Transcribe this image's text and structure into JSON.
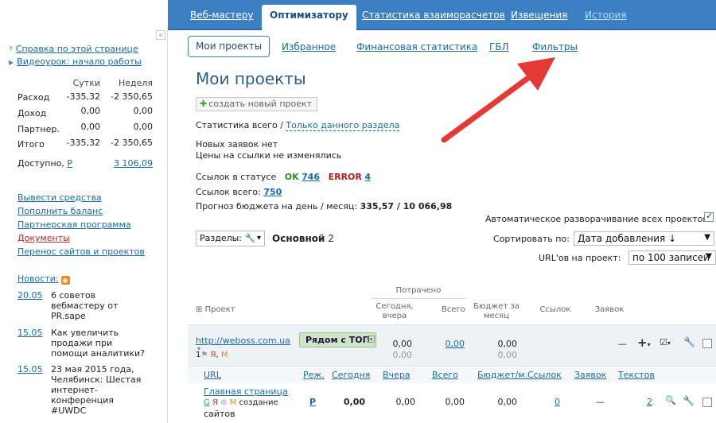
{
  "top_nav": [
    {
      "label": "Веб-мастеру"
    },
    {
      "label": "Оптимизатору"
    },
    {
      "label": "Статистика взаиморасчетов"
    },
    {
      "label": "Извещения"
    },
    {
      "label": "История"
    }
  ],
  "sidebar": {
    "collapse": "«",
    "help_link": "Справка по этой странице",
    "video_link": "Видеоурок: начало работы",
    "col_day": "Сутки",
    "col_week": "Неделя",
    "rows": [
      {
        "label": "Расход",
        "day": "-335,32",
        "week": "-2 350,65"
      },
      {
        "label": "Доход",
        "day": "0,00",
        "week": "0,00"
      },
      {
        "label": "Партнер.",
        "day": "0,00",
        "week": "0,00"
      },
      {
        "label": "Итого",
        "day": "-335,32",
        "week": "-2 350,65"
      }
    ],
    "available_label": "Доступно,",
    "available_currency": "Р",
    "available_value": "3 106,09",
    "links": [
      "Вывести средства",
      "Пополнить баланс",
      "Партнерская программа",
      "Документы",
      "Перенос сайтов и проектов"
    ],
    "news_label": "Новости:",
    "news": [
      {
        "date": "20.05",
        "text1": "6 советов",
        "text2": "вебмастеру от",
        "text3": "PR.sape",
        "text4": ""
      },
      {
        "date": "15.05",
        "text1": "Как увеличить",
        "text2": "продажи при",
        "text3": "помощи аналитики?",
        "text4": ""
      },
      {
        "date": "15.05",
        "text1": "23 мая 2015 года,",
        "text2": "Челябинск: Шестая",
        "text3": "интернет-",
        "text4": "конференция",
        "text5": "#UWDC"
      }
    ]
  },
  "sub_nav": [
    "Мои проекты",
    "Избранное",
    "Финансовая статистика",
    "ГБЛ",
    "Фильтры"
  ],
  "main": {
    "title": "Мои проекты",
    "create_button": "создать новый проект",
    "stats_all": "Статистика всего",
    "stats_sep": "/",
    "stats_section": "Только данного раздела",
    "no_new_requests": "Новых заявок нет",
    "prices_unchanged": "Цены на ссылки не изменялись",
    "links_status_label": "Ссылок в статусе",
    "ok_label": "OK",
    "ok_count": "746",
    "error_label": "ERROR",
    "error_count": "4",
    "links_total_label": "Ссылок всего:",
    "links_total": "750",
    "forecast_label": "Прогноз бюджета на день / месяц:",
    "forecast_value": "335,57 / 10 066,98",
    "auto_expand": "Автоматическое разворачивание всех проектов",
    "sections_label": "Разделы:",
    "sections_main": "Основной",
    "sections_count": "2",
    "sort_label": "Сортировать по:",
    "sort_value": "Дата добавления ↓",
    "urls_label": "URL'ов на проект:",
    "urls_value": "по 100 записей"
  },
  "table": {
    "spent_group": "Потрачено",
    "col_project": "Проект",
    "col_today": "Сегодня,",
    "col_today2": "вчера",
    "col_total": "Всего",
    "col_budget": "Бюджет за",
    "col_budget2": "месяц",
    "col_links": "Ссылок",
    "col_requests": "Заявок",
    "project": {
      "url": "http://weboss.com.ua",
      "meta": "1",
      "badge": "Рядом с ТОП",
      "today": "0,00",
      "yesterday": "0,00",
      "total": "0,00",
      "budget": "0,00",
      "budget2": "0,00",
      "requests": "—"
    },
    "detail_cols": [
      "URL",
      "Реж.",
      "Сегодня",
      "Вчера",
      "Всего",
      "Бюджет/м.",
      "Ссылок",
      "Заявок",
      "Текстов"
    ],
    "row": {
      "name": "Главная страница",
      "sub": "создание",
      "sub2": "сайтов",
      "mode": "Р",
      "today": "0,00",
      "yesterday": "0,00",
      "total": "0,00",
      "budget": "0,00",
      "links": "0",
      "requests": "—",
      "texts": "2"
    }
  },
  "colors": {
    "nav_blue": "#3b7fc2",
    "arrow_red": "#e53935",
    "ok_green": "#2e8b2e",
    "error_red": "#b71c1c"
  }
}
